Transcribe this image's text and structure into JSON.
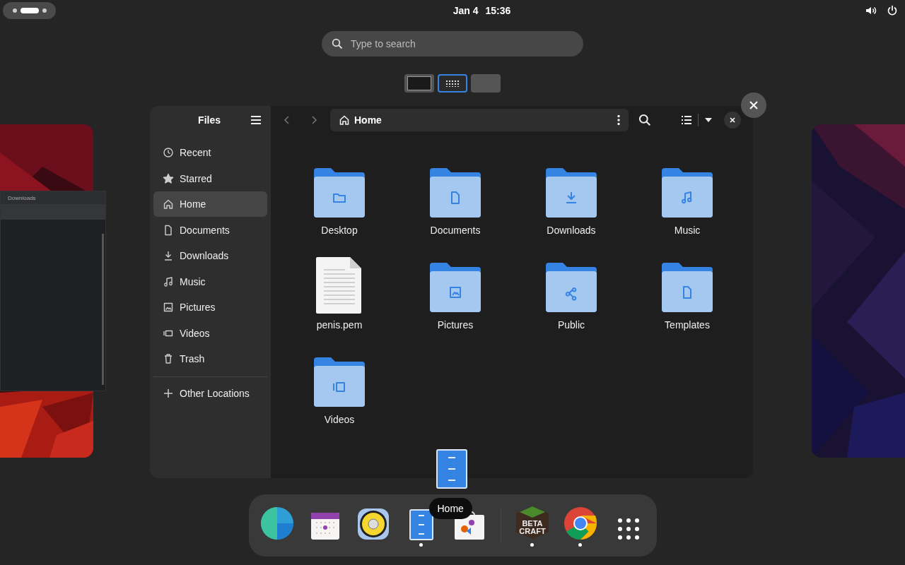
{
  "top_bar": {
    "date": "Jan 4",
    "time": "15:36"
  },
  "search": {
    "placeholder": "Type to search"
  },
  "workspaces": [
    {
      "selected": false
    },
    {
      "selected": true
    },
    {
      "selected": false
    }
  ],
  "left_preview": {
    "tab": "Downloads"
  },
  "files": {
    "sidebar_title": "Files",
    "places": [
      {
        "label": "Recent",
        "selected": false
      },
      {
        "label": "Starred",
        "selected": false
      },
      {
        "label": "Home",
        "selected": true
      },
      {
        "label": "Documents",
        "selected": false
      },
      {
        "label": "Downloads",
        "selected": false
      },
      {
        "label": "Music",
        "selected": false
      },
      {
        "label": "Pictures",
        "selected": false
      },
      {
        "label": "Videos",
        "selected": false
      },
      {
        "label": "Trash",
        "selected": false
      }
    ],
    "other_locations": "Other Locations",
    "path": "Home",
    "items": [
      {
        "name": "Desktop",
        "kind": "folder"
      },
      {
        "name": "Documents",
        "kind": "folder"
      },
      {
        "name": "Downloads",
        "kind": "folder"
      },
      {
        "name": "Music",
        "kind": "folder"
      },
      {
        "name": "penis.pem",
        "kind": "file"
      },
      {
        "name": "Pictures",
        "kind": "folder"
      },
      {
        "name": "Public",
        "kind": "folder"
      },
      {
        "name": "Templates",
        "kind": "folder"
      },
      {
        "name": "Videos",
        "kind": "folder"
      }
    ]
  },
  "tooltip": "Home",
  "dock": {
    "apps": [
      {
        "running": false
      },
      {
        "running": false
      },
      {
        "running": false
      },
      {
        "running": true
      },
      {
        "running": false
      },
      {
        "running": true,
        "label_lines": [
          "BETA",
          "CRAFT"
        ]
      },
      {
        "running": true
      },
      {
        "running": false
      }
    ]
  }
}
